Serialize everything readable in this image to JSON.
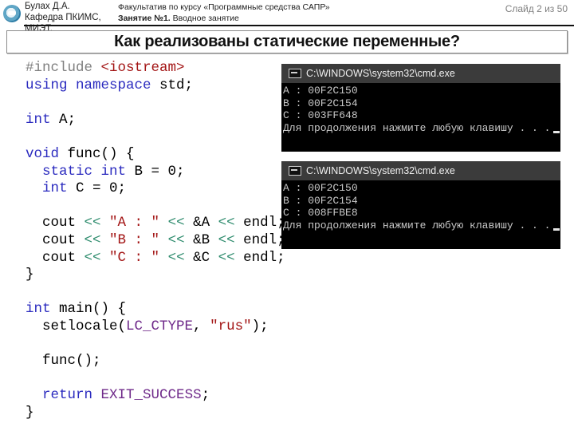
{
  "header": {
    "author_line1": "Булах Д.А.",
    "author_line2": "Кафедра ПКИМС, МИЭТ.",
    "course_line": "Факультатив по курсу «Программные средства САПР»",
    "lesson_bold": "Занятие №1.",
    "lesson_rest": " Вводное занятие",
    "slide_counter": "Слайд 2 из 50"
  },
  "slide": {
    "title": "Как реализованы статические переменные?"
  },
  "code": {
    "lines": [
      [
        {
          "t": "#include ",
          "c": "pp"
        },
        {
          "t": "<iostream>",
          "c": "str"
        }
      ],
      [
        {
          "t": "using namespace",
          "c": "kw"
        },
        {
          "t": " std;",
          "c": ""
        }
      ],
      [],
      [
        {
          "t": "int",
          "c": "kw"
        },
        {
          "t": " A;",
          "c": ""
        }
      ],
      [],
      [
        {
          "t": "void",
          "c": "kw"
        },
        {
          "t": " func() {",
          "c": ""
        }
      ],
      [
        {
          "t": "  ",
          "c": ""
        },
        {
          "t": "static int",
          "c": "kw"
        },
        {
          "t": " B = 0;",
          "c": ""
        }
      ],
      [
        {
          "t": "  ",
          "c": ""
        },
        {
          "t": "int",
          "c": "kw"
        },
        {
          "t": " C = 0;",
          "c": ""
        }
      ],
      [],
      [
        {
          "t": "  cout ",
          "c": ""
        },
        {
          "t": "<<",
          "c": "op"
        },
        {
          "t": " ",
          "c": ""
        },
        {
          "t": "\"A : \"",
          "c": "str"
        },
        {
          "t": " ",
          "c": ""
        },
        {
          "t": "<<",
          "c": "op"
        },
        {
          "t": " &A ",
          "c": ""
        },
        {
          "t": "<<",
          "c": "op"
        },
        {
          "t": " endl;",
          "c": ""
        }
      ],
      [
        {
          "t": "  cout ",
          "c": ""
        },
        {
          "t": "<<",
          "c": "op"
        },
        {
          "t": " ",
          "c": ""
        },
        {
          "t": "\"B : \"",
          "c": "str"
        },
        {
          "t": " ",
          "c": ""
        },
        {
          "t": "<<",
          "c": "op"
        },
        {
          "t": " &B ",
          "c": ""
        },
        {
          "t": "<<",
          "c": "op"
        },
        {
          "t": " endl;",
          "c": ""
        }
      ],
      [
        {
          "t": "  cout ",
          "c": ""
        },
        {
          "t": "<<",
          "c": "op"
        },
        {
          "t": " ",
          "c": ""
        },
        {
          "t": "\"C : \"",
          "c": "str"
        },
        {
          "t": " ",
          "c": ""
        },
        {
          "t": "<<",
          "c": "op"
        },
        {
          "t": " &C ",
          "c": ""
        },
        {
          "t": "<<",
          "c": "op"
        },
        {
          "t": " endl;",
          "c": ""
        }
      ],
      [
        {
          "t": "}",
          "c": ""
        }
      ],
      [],
      [
        {
          "t": "int",
          "c": "kw"
        },
        {
          "t": " main() {",
          "c": ""
        }
      ],
      [
        {
          "t": "  setlocale(",
          "c": ""
        },
        {
          "t": "LC_CTYPE",
          "c": "mac"
        },
        {
          "t": ", ",
          "c": ""
        },
        {
          "t": "\"rus\"",
          "c": "str"
        },
        {
          "t": ");",
          "c": ""
        }
      ],
      [],
      [
        {
          "t": "  func();",
          "c": ""
        }
      ],
      [],
      [
        {
          "t": "  ",
          "c": ""
        },
        {
          "t": "return",
          "c": "kw"
        },
        {
          "t": " ",
          "c": ""
        },
        {
          "t": "EXIT_SUCCESS",
          "c": "mac"
        },
        {
          "t": ";",
          "c": ""
        }
      ],
      [
        {
          "t": "}",
          "c": ""
        }
      ]
    ]
  },
  "terminals": [
    {
      "title": "C:\\WINDOWS\\system32\\cmd.exe",
      "lines": [
        "A : 00F2C150",
        "B : 00F2C154",
        "C : 003FF648"
      ],
      "prompt": "Для продолжения нажмите любую клавишу . . ."
    },
    {
      "title": "C:\\WINDOWS\\system32\\cmd.exe",
      "lines": [
        "A : 00F2C150",
        "B : 00F2C154",
        "C : 008FFBE8"
      ],
      "prompt": "Для продолжения нажмите любую клавишу . . ."
    }
  ]
}
